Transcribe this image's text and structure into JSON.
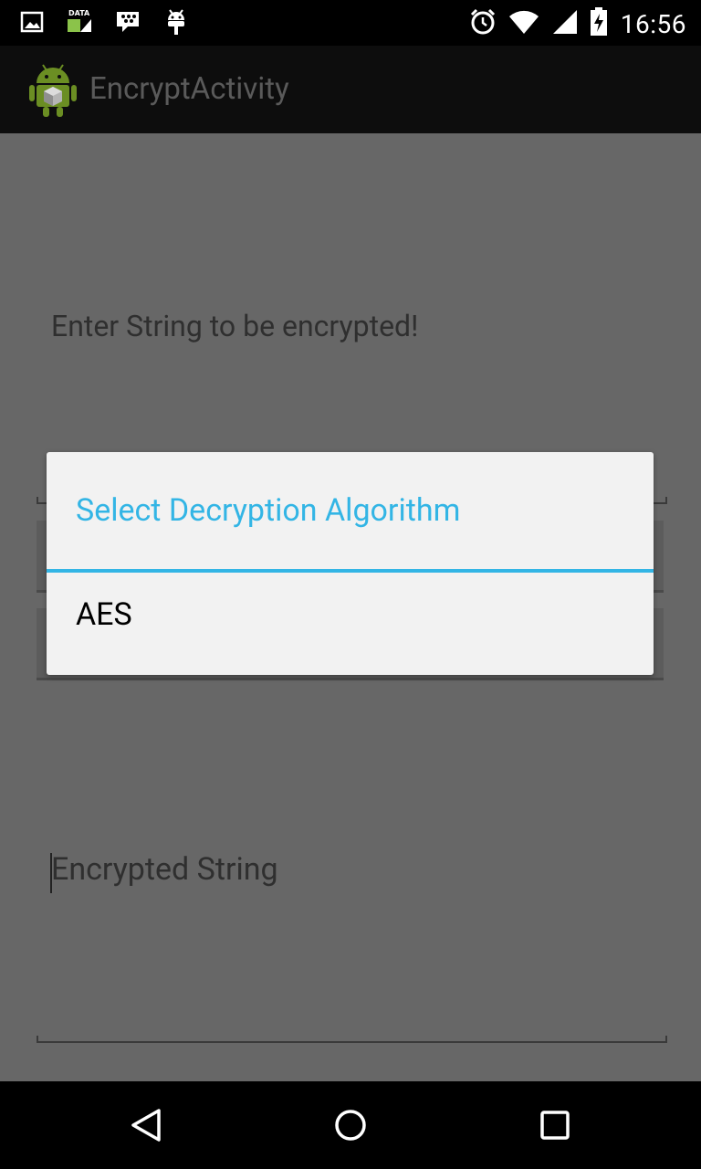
{
  "status_bar": {
    "time": "16:56",
    "data_label": "DATA",
    "icons": [
      "gallery-icon",
      "mobile-data-icon",
      "bbm-icon",
      "android-debug-icon",
      "alarm-icon",
      "wifi-icon",
      "cell-signal-icon",
      "battery-charging-icon"
    ]
  },
  "action_bar": {
    "title": "EncryptActivity",
    "app_icon": "android-app-icon"
  },
  "main": {
    "prompt": "Enter String to be encrypted!",
    "encrypted_placeholder": "Encrypted String"
  },
  "dialog": {
    "title": "Select Decryption Algorithm",
    "items": [
      {
        "label": "AES"
      }
    ],
    "accent": "#33b5e5"
  },
  "nav_bar": {
    "icons": [
      "back-icon",
      "home-icon",
      "recents-icon"
    ]
  }
}
